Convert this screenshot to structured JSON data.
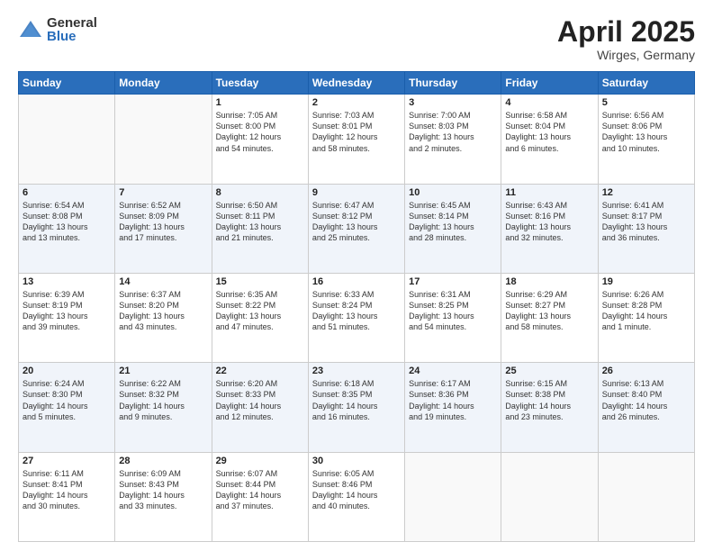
{
  "header": {
    "logo_general": "General",
    "logo_blue": "Blue",
    "month": "April 2025",
    "location": "Wirges, Germany"
  },
  "days_of_week": [
    "Sunday",
    "Monday",
    "Tuesday",
    "Wednesday",
    "Thursday",
    "Friday",
    "Saturday"
  ],
  "weeks": [
    [
      {
        "day": "",
        "info": ""
      },
      {
        "day": "",
        "info": ""
      },
      {
        "day": "1",
        "info": "Sunrise: 7:05 AM\nSunset: 8:00 PM\nDaylight: 12 hours\nand 54 minutes."
      },
      {
        "day": "2",
        "info": "Sunrise: 7:03 AM\nSunset: 8:01 PM\nDaylight: 12 hours\nand 58 minutes."
      },
      {
        "day": "3",
        "info": "Sunrise: 7:00 AM\nSunset: 8:03 PM\nDaylight: 13 hours\nand 2 minutes."
      },
      {
        "day": "4",
        "info": "Sunrise: 6:58 AM\nSunset: 8:04 PM\nDaylight: 13 hours\nand 6 minutes."
      },
      {
        "day": "5",
        "info": "Sunrise: 6:56 AM\nSunset: 8:06 PM\nDaylight: 13 hours\nand 10 minutes."
      }
    ],
    [
      {
        "day": "6",
        "info": "Sunrise: 6:54 AM\nSunset: 8:08 PM\nDaylight: 13 hours\nand 13 minutes."
      },
      {
        "day": "7",
        "info": "Sunrise: 6:52 AM\nSunset: 8:09 PM\nDaylight: 13 hours\nand 17 minutes."
      },
      {
        "day": "8",
        "info": "Sunrise: 6:50 AM\nSunset: 8:11 PM\nDaylight: 13 hours\nand 21 minutes."
      },
      {
        "day": "9",
        "info": "Sunrise: 6:47 AM\nSunset: 8:12 PM\nDaylight: 13 hours\nand 25 minutes."
      },
      {
        "day": "10",
        "info": "Sunrise: 6:45 AM\nSunset: 8:14 PM\nDaylight: 13 hours\nand 28 minutes."
      },
      {
        "day": "11",
        "info": "Sunrise: 6:43 AM\nSunset: 8:16 PM\nDaylight: 13 hours\nand 32 minutes."
      },
      {
        "day": "12",
        "info": "Sunrise: 6:41 AM\nSunset: 8:17 PM\nDaylight: 13 hours\nand 36 minutes."
      }
    ],
    [
      {
        "day": "13",
        "info": "Sunrise: 6:39 AM\nSunset: 8:19 PM\nDaylight: 13 hours\nand 39 minutes."
      },
      {
        "day": "14",
        "info": "Sunrise: 6:37 AM\nSunset: 8:20 PM\nDaylight: 13 hours\nand 43 minutes."
      },
      {
        "day": "15",
        "info": "Sunrise: 6:35 AM\nSunset: 8:22 PM\nDaylight: 13 hours\nand 47 minutes."
      },
      {
        "day": "16",
        "info": "Sunrise: 6:33 AM\nSunset: 8:24 PM\nDaylight: 13 hours\nand 51 minutes."
      },
      {
        "day": "17",
        "info": "Sunrise: 6:31 AM\nSunset: 8:25 PM\nDaylight: 13 hours\nand 54 minutes."
      },
      {
        "day": "18",
        "info": "Sunrise: 6:29 AM\nSunset: 8:27 PM\nDaylight: 13 hours\nand 58 minutes."
      },
      {
        "day": "19",
        "info": "Sunrise: 6:26 AM\nSunset: 8:28 PM\nDaylight: 14 hours\nand 1 minute."
      }
    ],
    [
      {
        "day": "20",
        "info": "Sunrise: 6:24 AM\nSunset: 8:30 PM\nDaylight: 14 hours\nand 5 minutes."
      },
      {
        "day": "21",
        "info": "Sunrise: 6:22 AM\nSunset: 8:32 PM\nDaylight: 14 hours\nand 9 minutes."
      },
      {
        "day": "22",
        "info": "Sunrise: 6:20 AM\nSunset: 8:33 PM\nDaylight: 14 hours\nand 12 minutes."
      },
      {
        "day": "23",
        "info": "Sunrise: 6:18 AM\nSunset: 8:35 PM\nDaylight: 14 hours\nand 16 minutes."
      },
      {
        "day": "24",
        "info": "Sunrise: 6:17 AM\nSunset: 8:36 PM\nDaylight: 14 hours\nand 19 minutes."
      },
      {
        "day": "25",
        "info": "Sunrise: 6:15 AM\nSunset: 8:38 PM\nDaylight: 14 hours\nand 23 minutes."
      },
      {
        "day": "26",
        "info": "Sunrise: 6:13 AM\nSunset: 8:40 PM\nDaylight: 14 hours\nand 26 minutes."
      }
    ],
    [
      {
        "day": "27",
        "info": "Sunrise: 6:11 AM\nSunset: 8:41 PM\nDaylight: 14 hours\nand 30 minutes."
      },
      {
        "day": "28",
        "info": "Sunrise: 6:09 AM\nSunset: 8:43 PM\nDaylight: 14 hours\nand 33 minutes."
      },
      {
        "day": "29",
        "info": "Sunrise: 6:07 AM\nSunset: 8:44 PM\nDaylight: 14 hours\nand 37 minutes."
      },
      {
        "day": "30",
        "info": "Sunrise: 6:05 AM\nSunset: 8:46 PM\nDaylight: 14 hours\nand 40 minutes."
      },
      {
        "day": "",
        "info": ""
      },
      {
        "day": "",
        "info": ""
      },
      {
        "day": "",
        "info": ""
      }
    ]
  ]
}
